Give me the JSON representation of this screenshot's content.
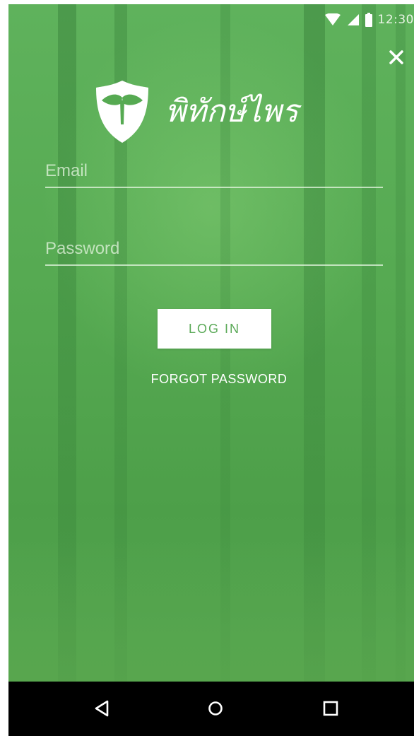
{
  "status_bar": {
    "time": "12:30",
    "icons": [
      "wifi-icon",
      "cell-signal-icon",
      "battery-icon"
    ]
  },
  "close_icon": "close-icon",
  "logo": {
    "icon": "shield-leaf-icon",
    "text": "พิทักษ์ไพร"
  },
  "form": {
    "email": {
      "placeholder": "Email",
      "value": ""
    },
    "password": {
      "placeholder": "Password",
      "value": ""
    },
    "login_label": "LOG IN",
    "forgot_label": "FORGOT PASSWORD"
  },
  "nav_bar": {
    "icons": [
      "back-icon",
      "home-icon",
      "recents-icon"
    ]
  },
  "colors": {
    "background_green": "#56aa52",
    "button_text": "#5aa957",
    "white": "#ffffff",
    "nav_bar": "#000000"
  }
}
